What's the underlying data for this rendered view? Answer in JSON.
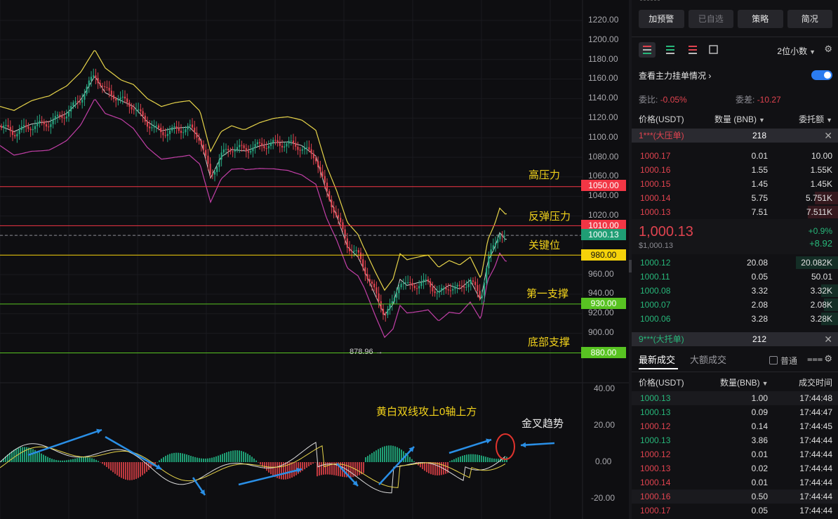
{
  "chart": {
    "price_ticks": [
      "1220.00",
      "1200.00",
      "1180.00",
      "1160.00",
      "1140.00",
      "1120.00",
      "1100.00",
      "1080.00",
      "1060.00",
      "1040.00",
      "1020.00",
      "960.00",
      "940.00",
      "920.00",
      "900.00"
    ],
    "macd_ticks": [
      "40.00",
      "20.00",
      "0.00",
      "-20.00"
    ],
    "low_label": "878.96 →",
    "levels": [
      {
        "label": "1050.00",
        "color": "#f23645",
        "text_color": "#ffffff",
        "annotation": "高压力"
      },
      {
        "label": "1010.00",
        "color": "#f23645",
        "text_color": "#ffffff",
        "annotation": "反弹压力"
      },
      {
        "label": "980.00",
        "color": "#f5d20a",
        "text_color": "#111111",
        "annotation": "关键位"
      },
      {
        "label": "930.00",
        "color": "#58c322",
        "text_color": "#ffffff",
        "annotation": "第一支撑"
      },
      {
        "label": "880.00",
        "color": "#58c322",
        "text_color": "#ffffff",
        "annotation": "底部支撑"
      }
    ],
    "current_price_label": "1000.13",
    "current_price_color": "#1f9e74",
    "macd_annotation": "黄白双线攻上0轴上方",
    "golden_cross_annotation": "金叉趋势"
  },
  "panel": {
    "buttons": [
      "加预警",
      "已自选",
      "策略",
      "简况"
    ],
    "precision": "2位小数",
    "order_book_label": "查看主力挂单情况",
    "ratio_label": "委比:",
    "ratio_value": "-0.05%",
    "diff_label": "委差:",
    "diff_value": "-10.27",
    "col_price": "价格(USDT)",
    "col_qty": "数量 (BNB)",
    "col_total": "委托额",
    "big_ask_label": "1***(大压单)",
    "big_ask_value": "218",
    "asks": [
      {
        "price": "1000.17",
        "qty": "0.01",
        "total": "10.00",
        "depth": 0
      },
      {
        "price": "1000.16",
        "qty": "1.55",
        "total": "1.55K",
        "depth": 0
      },
      {
        "price": "1000.15",
        "qty": "1.45",
        "total": "1.45K",
        "depth": 0
      },
      {
        "price": "1000.14",
        "qty": "5.75",
        "total": "5.751K",
        "depth": 0.55
      },
      {
        "price": "1000.13",
        "qty": "7.51",
        "total": "7.511K",
        "depth": 0.72
      }
    ],
    "last_price": "1,000.13",
    "last_price_usd": "$1,000.13",
    "change_pct": "+0.9%",
    "change_abs": "+8.92",
    "bids": [
      {
        "price": "1000.12",
        "qty": "20.08",
        "total": "20.082K",
        "depth": 1.0
      },
      {
        "price": "1000.11",
        "qty": "0.05",
        "total": "50.01",
        "depth": 0
      },
      {
        "price": "1000.08",
        "qty": "3.32",
        "total": "3.32K",
        "depth": 0.4
      },
      {
        "price": "1000.07",
        "qty": "2.08",
        "total": "2.08K",
        "depth": 0.33
      },
      {
        "price": "1000.06",
        "qty": "3.28",
        "total": "3.28K",
        "depth": 0.4
      }
    ],
    "big_bid_label": "9***(大托单)",
    "big_bid_value": "212",
    "tab_latest": "最新成交",
    "tab_large": "大额成交",
    "normal_label": "普通",
    "trade_col_price": "价格(USDT)",
    "trade_col_qty": "数量(BNB)",
    "trade_col_time": "成交时间",
    "trades": [
      {
        "price": "1000.13",
        "side": "buy",
        "qty": "1.00",
        "time": "17:44:48"
      },
      {
        "price": "1000.13",
        "side": "buy",
        "qty": "0.09",
        "time": "17:44:47"
      },
      {
        "price": "1000.12",
        "side": "sell",
        "qty": "0.14",
        "time": "17:44:45"
      },
      {
        "price": "1000.13",
        "side": "buy",
        "qty": "3.86",
        "time": "17:44:44"
      },
      {
        "price": "1000.12",
        "side": "sell",
        "qty": "0.01",
        "time": "17:44:44"
      },
      {
        "price": "1000.13",
        "side": "sell",
        "qty": "0.02",
        "time": "17:44:44"
      },
      {
        "price": "1000.14",
        "side": "sell",
        "qty": "0.01",
        "time": "17:44:44"
      },
      {
        "price": "1000.16",
        "side": "sell",
        "qty": "0.50",
        "time": "17:44:44"
      },
      {
        "price": "1000.17",
        "side": "sell",
        "qty": "0.05",
        "time": "17:44:44"
      }
    ],
    "colors": {
      "buy": "#27b77a",
      "sell": "#e0434f",
      "accent": "#2b7cf0"
    }
  }
}
